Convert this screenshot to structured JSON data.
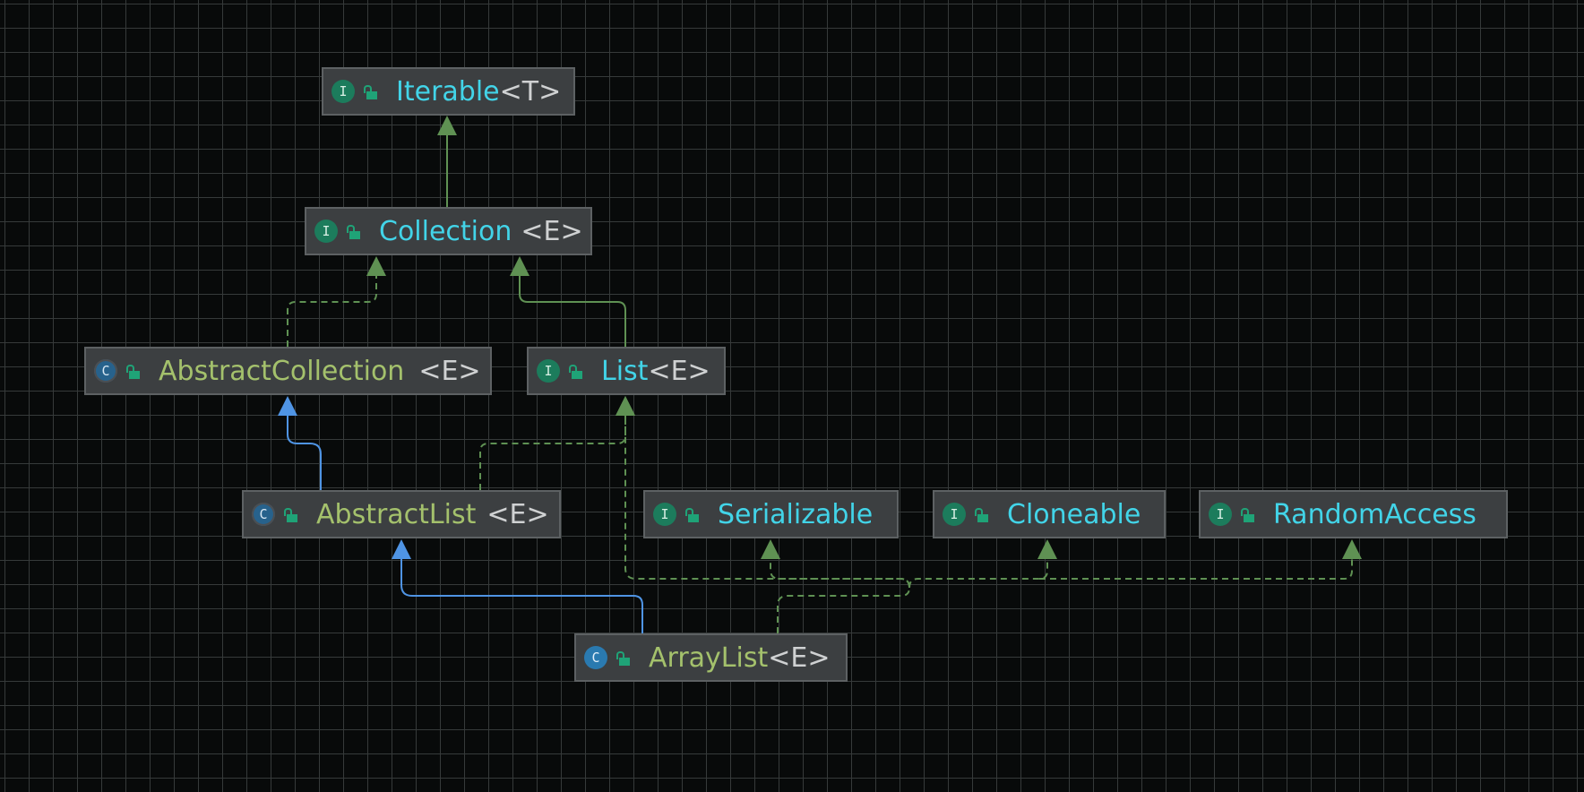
{
  "diagram": {
    "colors": {
      "background": "#080a0a",
      "grid": "#363a3a",
      "node_fill": "#3c3f41",
      "node_border": "#5d6163",
      "interface_name": "#42d4e8",
      "class_name": "#a4c16c",
      "generic_text": "#cfd1d2",
      "implements_edge": "#5f9153",
      "extends_edge": "#4f94e4"
    },
    "nodes": {
      "iterable": {
        "kind": "interface",
        "icon_letter": "I",
        "icon": "interface-icon",
        "name": "Iterable",
        "generic": "<T>"
      },
      "collection": {
        "kind": "interface",
        "icon_letter": "I",
        "icon": "interface-icon",
        "name": "Collection",
        "generic": "<E>"
      },
      "abstract_collection": {
        "kind": "abstract-class",
        "icon_letter": "C",
        "icon": "abstract-class-icon",
        "name": "AbstractCollection",
        "generic": "<E>"
      },
      "list": {
        "kind": "interface",
        "icon_letter": "I",
        "icon": "interface-icon",
        "name": "List",
        "generic": "<E>"
      },
      "abstract_list": {
        "kind": "abstract-class",
        "icon_letter": "C",
        "icon": "abstract-class-icon",
        "name": "AbstractList",
        "generic": "<E>"
      },
      "serializable": {
        "kind": "interface",
        "icon_letter": "I",
        "icon": "interface-icon",
        "name": "Serializable",
        "generic": ""
      },
      "cloneable": {
        "kind": "interface",
        "icon_letter": "I",
        "icon": "interface-icon",
        "name": "Cloneable",
        "generic": ""
      },
      "random_access": {
        "kind": "interface",
        "icon_letter": "I",
        "icon": "interface-icon",
        "name": "RandomAccess",
        "generic": ""
      },
      "array_list": {
        "kind": "class",
        "icon_letter": "C",
        "icon": "class-icon",
        "name": "ArrayList",
        "generic": "<E>"
      }
    },
    "edges": [
      {
        "from": "collection",
        "to": "iterable",
        "type": "extends-interface",
        "style": "solid-green"
      },
      {
        "from": "abstract_collection",
        "to": "collection",
        "type": "implements",
        "style": "dashed-green"
      },
      {
        "from": "list",
        "to": "collection",
        "type": "extends-interface",
        "style": "solid-green"
      },
      {
        "from": "abstract_list",
        "to": "abstract_collection",
        "type": "extends",
        "style": "solid-blue"
      },
      {
        "from": "abstract_list",
        "to": "list",
        "type": "implements",
        "style": "dashed-green"
      },
      {
        "from": "array_list",
        "to": "abstract_list",
        "type": "extends",
        "style": "solid-blue"
      },
      {
        "from": "array_list",
        "to": "list",
        "type": "implements",
        "style": "dashed-green"
      },
      {
        "from": "array_list",
        "to": "serializable",
        "type": "implements",
        "style": "dashed-green"
      },
      {
        "from": "array_list",
        "to": "cloneable",
        "type": "implements",
        "style": "dashed-green"
      },
      {
        "from": "array_list",
        "to": "random_access",
        "type": "implements",
        "style": "dashed-green"
      }
    ]
  }
}
